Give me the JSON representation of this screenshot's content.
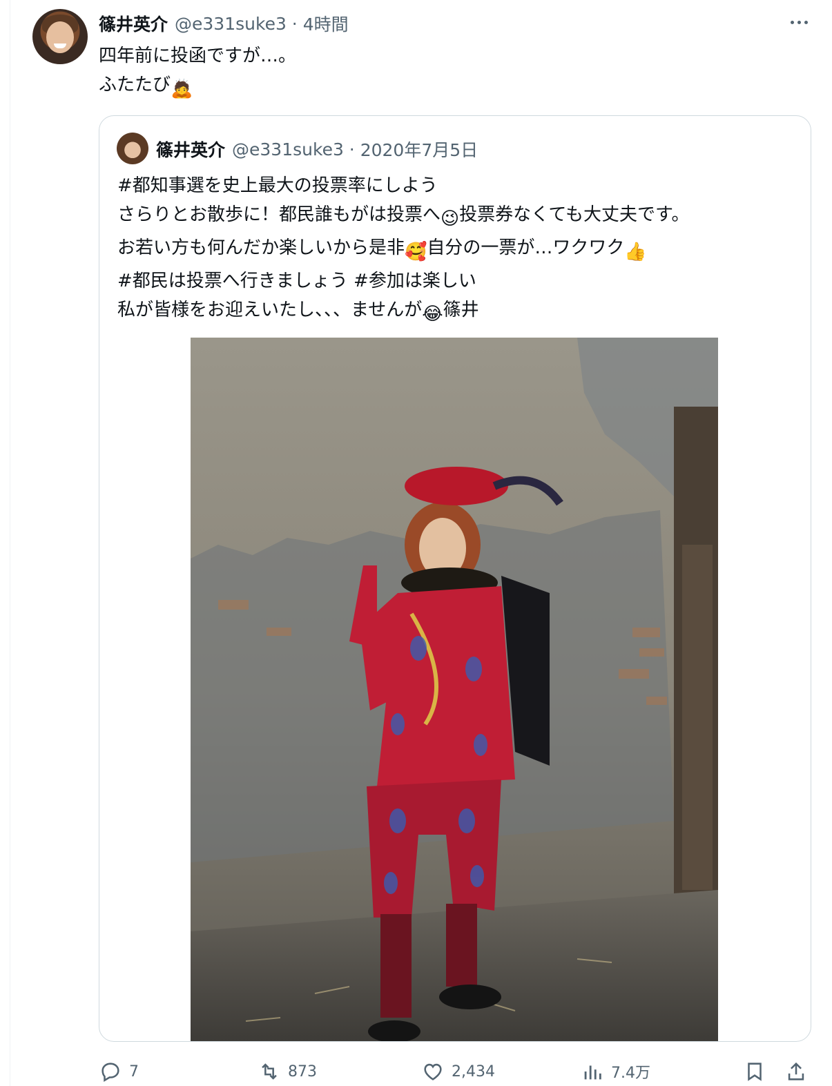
{
  "tweet": {
    "author_name": "篠井英介",
    "handle": "@e331suke3",
    "time": "4時間",
    "text_lines": [
      "四年前に投函ですが…。",
      "ふたたび"
    ],
    "line2_emoji": "🙇"
  },
  "quoted_tweet": {
    "author_name": "篠井英介",
    "handle": "@e331suke3",
    "date": "2020年7月5日",
    "line1": "#都知事選を史上最大の投票率にしよう",
    "line2a": "さらりとお散歩に！都民誰もがは投票へ",
    "line2_emoji": "😉",
    "line2b": "投票券なくても大丈夫です。",
    "line3a": "お若い方も何んだか楽しいから是非",
    "line3_emoji1": "🥰",
    "line3b": "自分の一票が…ワクワク",
    "line3_emoji2": "👍",
    "line4": "#都民は投票へ行きましょう #参加は楽しい",
    "line5a": "私が皆様をお迎えいたし、、、ませんが",
    "line5_emoji": "😂",
    "line5b": "篠井"
  },
  "actions": {
    "replies": "7",
    "reposts": "873",
    "likes": "2,434",
    "views": "7.4万"
  },
  "icons": [
    "more-icon",
    "reply-icon",
    "repost-icon",
    "like-icon",
    "views-icon",
    "bookmark-icon",
    "share-icon"
  ],
  "colors": {
    "text": "#0f1419",
    "secondary": "#536471",
    "border": "#cfd9de"
  }
}
